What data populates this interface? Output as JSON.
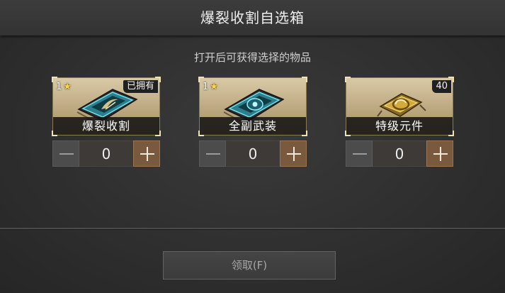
{
  "dialog": {
    "title": "爆裂收割自选箱",
    "subtitle": "打开后可获得选择的物品",
    "claim_label": "领取(F)"
  },
  "items": [
    {
      "name": "爆裂收割",
      "level": "1",
      "star": "★",
      "badge": "已拥有",
      "quantity": "0",
      "icon": "scythe-chip-icon"
    },
    {
      "name": "全副武装",
      "level": "1",
      "star": "★",
      "badge": "",
      "quantity": "0",
      "icon": "armor-chip-icon"
    },
    {
      "name": "特级元件",
      "level": "",
      "star": "",
      "badge": "40",
      "quantity": "0",
      "icon": "gold-component-icon"
    }
  ],
  "colors": {
    "card_gold": "#c9b78f",
    "plus_button": "#7a5a3e",
    "star": "#ffd34a"
  }
}
